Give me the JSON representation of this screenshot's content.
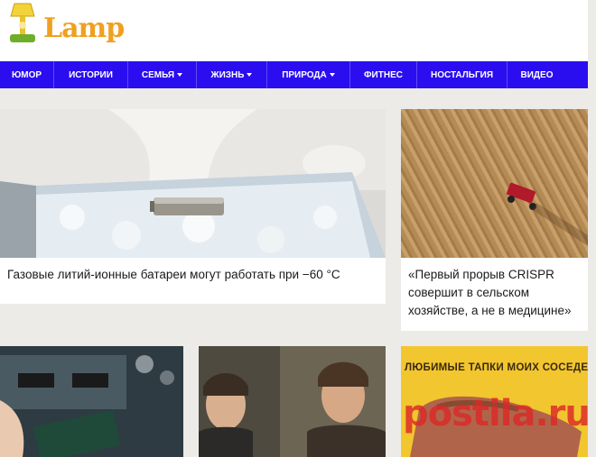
{
  "site": {
    "logo_text": "Lamp"
  },
  "nav": {
    "items": [
      {
        "label": "ЮМОР",
        "dropdown": false
      },
      {
        "label": "ИСТОРИИ",
        "dropdown": false
      },
      {
        "label": "СЕМЬЯ",
        "dropdown": true
      },
      {
        "label": "ЖИЗНЬ",
        "dropdown": true
      },
      {
        "label": "ПРИРОДА",
        "dropdown": true
      },
      {
        "label": "ФИТНЕС",
        "dropdown": false
      },
      {
        "label": "НОСТАЛЬГИЯ",
        "dropdown": false
      },
      {
        "label": "ВИДЕО",
        "dropdown": false
      }
    ]
  },
  "articles": [
    {
      "title": "Газовые литий-ионные батареи могут работать при −60 °C"
    },
    {
      "title": "«Первый прорыв CRISPR совершит в сельском хозяйстве, а не в медицине»"
    },
    {
      "title": ""
    },
    {
      "title": ""
    },
    {
      "image_text": "ЛЮБИМЫЕ ТАПКИ МОИХ СОСЕДЕЙ"
    }
  ],
  "watermark": "postila.ru",
  "colors": {
    "nav_bg": "#2a0ef0",
    "page_bg": "#ecebe8",
    "logo_accent": "#f0a020",
    "watermark": "#dc2828"
  }
}
